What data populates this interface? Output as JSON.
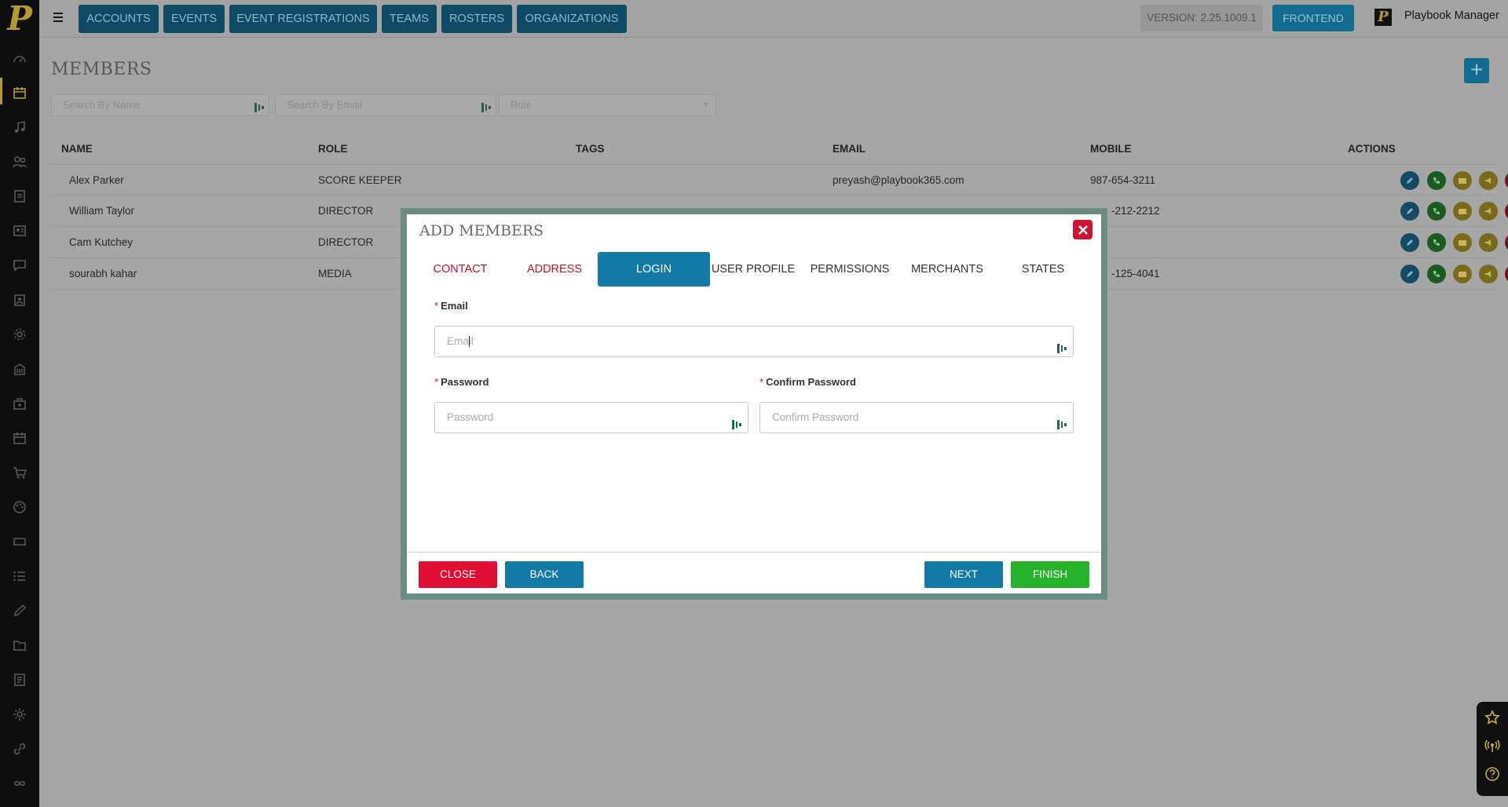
{
  "app": {
    "logo_letter": "P",
    "nav": [
      "ACCOUNTS",
      "EVENTS",
      "EVENT REGISTRATIONS",
      "TEAMS",
      "ROSTERS",
      "ORGANIZATIONS"
    ],
    "version": "VERSION: 2.25.1009.1",
    "frontend_label": "FRONTEND",
    "user_name": "Playbook Manager"
  },
  "page": {
    "title": "MEMBERS",
    "add_label": "+",
    "filters": {
      "name_placeholder": "Search By Name",
      "email_placeholder": "Search By Email",
      "role_placeholder": "Role"
    },
    "columns": [
      "NAME",
      "ROLE",
      "TAGS",
      "EMAIL",
      "MOBILE",
      "ACTIONS"
    ],
    "rows": [
      {
        "name": "Alex Parker",
        "role": "SCORE KEEPER",
        "tags": "",
        "email": "preyash@playbook365.com",
        "mobile": "987-654-3211"
      },
      {
        "name": "William Taylor",
        "role": "DIRECTOR",
        "tags": "",
        "email": "",
        "mobile": "-212-2212"
      },
      {
        "name": "Cam Kutchey",
        "role": "DIRECTOR",
        "tags": "",
        "email": "",
        "mobile": ""
      },
      {
        "name": "sourabh kahar",
        "role": "MEDIA",
        "tags": "",
        "email": "",
        "mobile": "-125-4041"
      }
    ]
  },
  "modal": {
    "title": "ADD MEMBERS",
    "tabs": [
      "CONTACT",
      "ADDRESS",
      "LOGIN",
      "USER PROFILE",
      "PERMISSIONS",
      "MERCHANTS",
      "STATES"
    ],
    "active_tab": "LOGIN",
    "required_mark": "*",
    "email_label": "Email",
    "email_placeholder": "Email",
    "password_label": "Password",
    "password_placeholder": "Password",
    "confirm_label": "Confirm Password",
    "confirm_placeholder": "Confirm Password",
    "buttons": {
      "close": "CLOSE",
      "back": "BACK",
      "next": "NEXT",
      "finish": "FINISH"
    }
  },
  "colors": {
    "brand_gold": "#b69b2c",
    "primary_blue": "#1379a5",
    "danger_red": "#d11131",
    "success_green": "#25b22b"
  }
}
